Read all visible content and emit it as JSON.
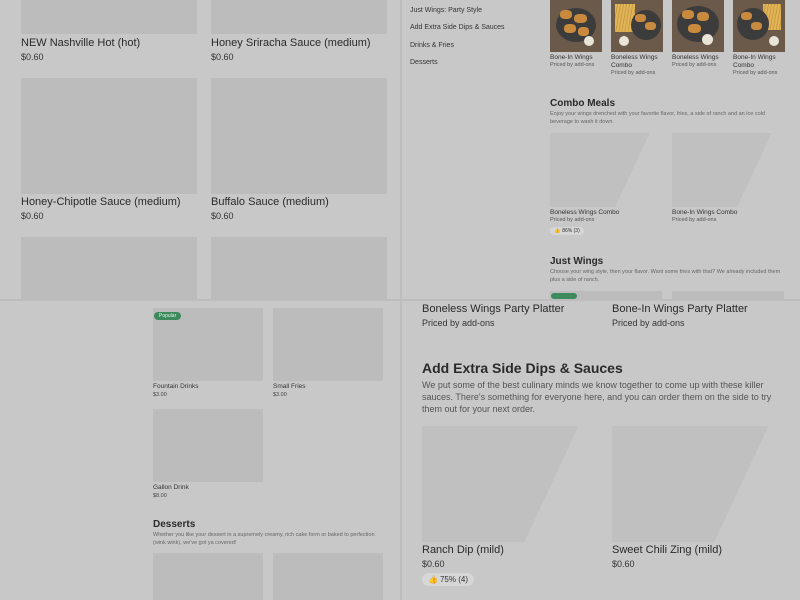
{
  "q1": {
    "items": [
      {
        "name": "NEW Nashville Hot (hot)",
        "price": "$0.60"
      },
      {
        "name": "Honey Sriracha Sauce (medium)",
        "price": "$0.60"
      },
      {
        "name": "Honey-Chipotle Sauce (medium)",
        "price": "$0.60"
      },
      {
        "name": "Buffalo Sauce (medium)",
        "price": "$0.60"
      }
    ]
  },
  "q2": {
    "nav": [
      "Just Wings: Party Style",
      "Add Extra Side Dips & Sauces",
      "Drinks & Fries",
      "Desserts"
    ],
    "top_items": [
      {
        "name": "Bone-In Wings",
        "sub": "Priced by add-ons"
      },
      {
        "name": "Boneless Wings Combo",
        "sub": "Priced by add-ons"
      },
      {
        "name": "Boneless Wings",
        "sub": "Priced by add-ons"
      },
      {
        "name": "Bone-In Wings Combo",
        "sub": "Priced by add-ons"
      }
    ],
    "combo": {
      "title": "Combo Meals",
      "desc": "Enjoy your wings drenched with your favorite flavor, fries, a side of ranch and an ice cold beverage to wash it down.",
      "items": [
        {
          "name": "Boneless Wings Combo",
          "sub": "Priced by add-ons",
          "rating": "86% (3)"
        },
        {
          "name": "Bone-In Wings Combo",
          "sub": "Priced by add-ons"
        }
      ]
    },
    "just_wings": {
      "title": "Just Wings",
      "desc": "Choose your wing style, then your flavor. Want some fries with that? We already included them plus a side of ranch."
    }
  },
  "q3": {
    "popular": "Popular",
    "items": [
      {
        "name": "Fountain Drinks",
        "price": "$3.00"
      },
      {
        "name": "Small Fries",
        "price": "$3.00"
      },
      {
        "name": "Gallon Drink",
        "price": "$8.00"
      }
    ],
    "desserts": {
      "title": "Desserts",
      "desc": "Whether you like your dessert in a supremely creamy, rich cake form or baked to perfection (wink wink), we've got ya covered!"
    }
  },
  "q4": {
    "top": [
      {
        "name": "Boneless Wings Party Platter",
        "sub": "Priced by add-ons"
      },
      {
        "name": "Bone-In Wings Party Platter",
        "sub": "Priced by add-ons"
      }
    ],
    "section": {
      "title": "Add Extra Side Dips & Sauces",
      "desc": "We put some of the best culinary minds we know together to come up with these killer sauces. There's something for everyone here, and you can order them on the side to try them out for your next order."
    },
    "items": [
      {
        "name": "Ranch Dip (mild)",
        "price": "$0.60",
        "rating": "75% (4)"
      },
      {
        "name": "Sweet Chili Zing (mild)",
        "price": "$0.60"
      }
    ]
  }
}
